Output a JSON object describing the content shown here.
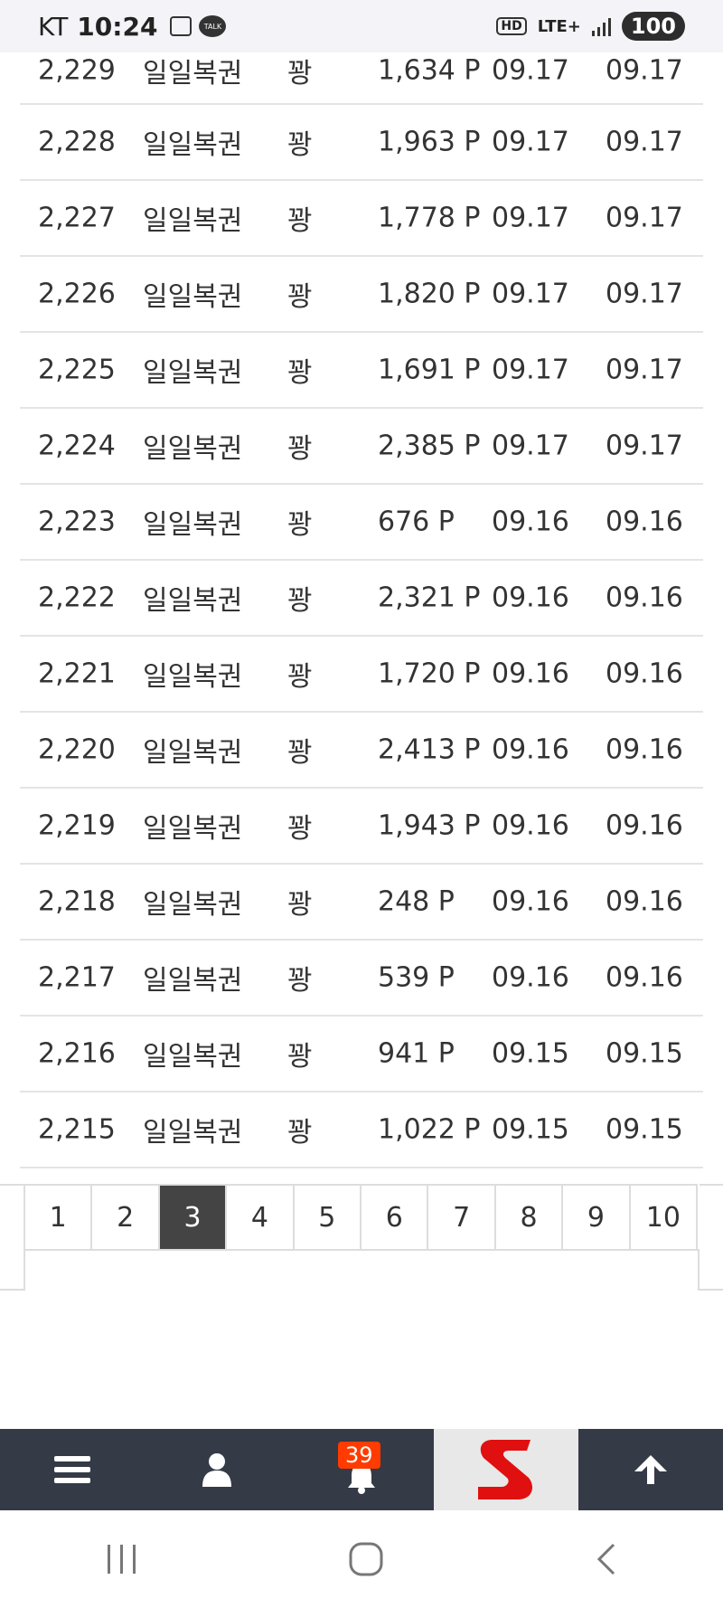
{
  "status_bar": {
    "carrier": "KT",
    "time": "10:24",
    "network": "LTE+",
    "hd": "HD",
    "battery": "100"
  },
  "rows": [
    {
      "no": "2,229",
      "title": "일일복권",
      "kind": "꽝",
      "point": "1,634 P",
      "date1": "09.17",
      "date2": "09.17"
    },
    {
      "no": "2,228",
      "title": "일일복권",
      "kind": "꽝",
      "point": "1,963 P",
      "date1": "09.17",
      "date2": "09.17"
    },
    {
      "no": "2,227",
      "title": "일일복권",
      "kind": "꽝",
      "point": "1,778 P",
      "date1": "09.17",
      "date2": "09.17"
    },
    {
      "no": "2,226",
      "title": "일일복권",
      "kind": "꽝",
      "point": "1,820 P",
      "date1": "09.17",
      "date2": "09.17"
    },
    {
      "no": "2,225",
      "title": "일일복권",
      "kind": "꽝",
      "point": "1,691 P",
      "date1": "09.17",
      "date2": "09.17"
    },
    {
      "no": "2,224",
      "title": "일일복권",
      "kind": "꽝",
      "point": "2,385 P",
      "date1": "09.17",
      "date2": "09.17"
    },
    {
      "no": "2,223",
      "title": "일일복권",
      "kind": "꽝",
      "point": "676 P",
      "date1": "09.16",
      "date2": "09.16"
    },
    {
      "no": "2,222",
      "title": "일일복권",
      "kind": "꽝",
      "point": "2,321 P",
      "date1": "09.16",
      "date2": "09.16"
    },
    {
      "no": "2,221",
      "title": "일일복권",
      "kind": "꽝",
      "point": "1,720 P",
      "date1": "09.16",
      "date2": "09.16"
    },
    {
      "no": "2,220",
      "title": "일일복권",
      "kind": "꽝",
      "point": "2,413 P",
      "date1": "09.16",
      "date2": "09.16"
    },
    {
      "no": "2,219",
      "title": "일일복권",
      "kind": "꽝",
      "point": "1,943 P",
      "date1": "09.16",
      "date2": "09.16"
    },
    {
      "no": "2,218",
      "title": "일일복권",
      "kind": "꽝",
      "point": "248 P",
      "date1": "09.16",
      "date2": "09.16"
    },
    {
      "no": "2,217",
      "title": "일일복권",
      "kind": "꽝",
      "point": "539 P",
      "date1": "09.16",
      "date2": "09.16"
    },
    {
      "no": "2,216",
      "title": "일일복권",
      "kind": "꽝",
      "point": "941 P",
      "date1": "09.15",
      "date2": "09.15"
    },
    {
      "no": "2,215",
      "title": "일일복권",
      "kind": "꽝",
      "point": "1,022 P",
      "date1": "09.15",
      "date2": "09.15"
    }
  ],
  "pagination": {
    "pages": [
      "1",
      "2",
      "3",
      "4",
      "5",
      "6",
      "7",
      "8",
      "9",
      "10"
    ],
    "current": "3"
  },
  "bottom_nav": {
    "notification_count": "39",
    "icons": [
      "menu-icon",
      "user-icon",
      "bell-icon",
      "site-logo",
      "arrow-up-icon"
    ]
  },
  "colors": {
    "nav_bg": "#343a46",
    "active_page_bg": "#444444",
    "badge_bg": "#ff3b00",
    "logo_red": "#e01010"
  }
}
